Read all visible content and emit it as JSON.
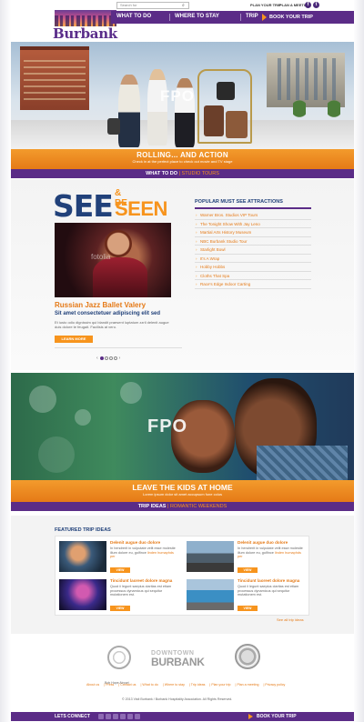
{
  "header": {
    "search_placeholder": "Search for",
    "plan_trip": "PLAN YOUR TRIP",
    "plan_meeting": "PLAN A MEETING",
    "social": [
      "f",
      "t"
    ]
  },
  "logo": {
    "text": "Burbank"
  },
  "nav": {
    "items": [
      "WHAT TO DO",
      "WHERE TO STAY",
      "TRIP IDEAS"
    ],
    "book": "BOOK YOUR TRIP"
  },
  "hero1": {
    "fpo": "FPO",
    "title": "ROLLING... AND ACTION",
    "subtitle": "Check in at the perfect place to check out movie and TV stage",
    "band_label": "WHAT TO DO",
    "band_highlight": "STUDIO TOURS"
  },
  "see_section": {
    "see": "SEE",
    "and_be": "& BE",
    "seen": "SEEN",
    "watermark": "fotolia",
    "title": "Russian Jazz Ballet Valery",
    "subtitle": "Sit amet consectetuer adipiscing elit sed",
    "body": "Et iusto odio dignissim qui blandit praesent luptatum zzril delenit augue duis dolore te feugait. Facilisis at vero.",
    "button": "LEARN MORE"
  },
  "attractions": {
    "heading": "POPULAR MUST SEE ATTRACTIONS",
    "items": [
      "Warner Bros. Studios VIP Tours",
      "The Tonight Show With Jay Leno",
      "Martial Arts History Museum",
      "NBC Burbank Studio Tour",
      "Starlight Bowl",
      "It's A Wrap",
      "Hobby Hobbs",
      "Cloths That Spa",
      "Race's Edge Indoor Carting"
    ]
  },
  "hero2": {
    "fpo": "FPO",
    "title": "LEAVE THE KIDS AT HOME",
    "subtitle": "Lorem ipsum dolor sit amet accupsum fune colus",
    "band_label": "TRIP IDEAS",
    "band_highlight": "ROMANTIC WEEKENDS"
  },
  "featured": {
    "heading": "FEATURED TRIP IDEAS",
    "trips": [
      {
        "title": "Delenit augue duo dolore",
        "body": "In hendrerit in vulputate velit esse molestie illum dolore eu, golfince",
        "link": "linden humaphds per",
        "button": "VIEW"
      },
      {
        "title": "Delenit augue duo dolore",
        "body": "In hendrerit in vulputate velit esse molestie illum dolore eu, golfince",
        "link": "linden humaphds per",
        "button": "VIEW"
      },
      {
        "title": "Tincidunt laoreet dolore magna",
        "body": "Quod ii legunt saepius claritas est etiam processus dynamicus qui sequitur mutationem est.",
        "link": "",
        "button": "VIEW"
      },
      {
        "title": "Tincidunt laoreet dolore magna",
        "body": "Quod ii legunt saepius claritas est etiam processus dynamicus qui sequitur mutationem est.",
        "link": "",
        "button": "VIEW"
      }
    ],
    "see_all": "See all trip ideas"
  },
  "footer": {
    "airport_label": "Bob Hope Airport",
    "downtown": "DOWNTOWN",
    "burbank": "BURBANK",
    "links": [
      "About us",
      "Press",
      "Contact us",
      "What to do",
      "Where to stay",
      "Trip ideas",
      "Plan your trip",
      "Plan a meeting",
      "Privacy policy"
    ],
    "copyright": "© 2013 Visit Burbank / Burbank Hospitality Association. All Rights Reserved.",
    "lets_connect": "LETS CONNECT",
    "book": "BOOK YOUR TRIP"
  }
}
